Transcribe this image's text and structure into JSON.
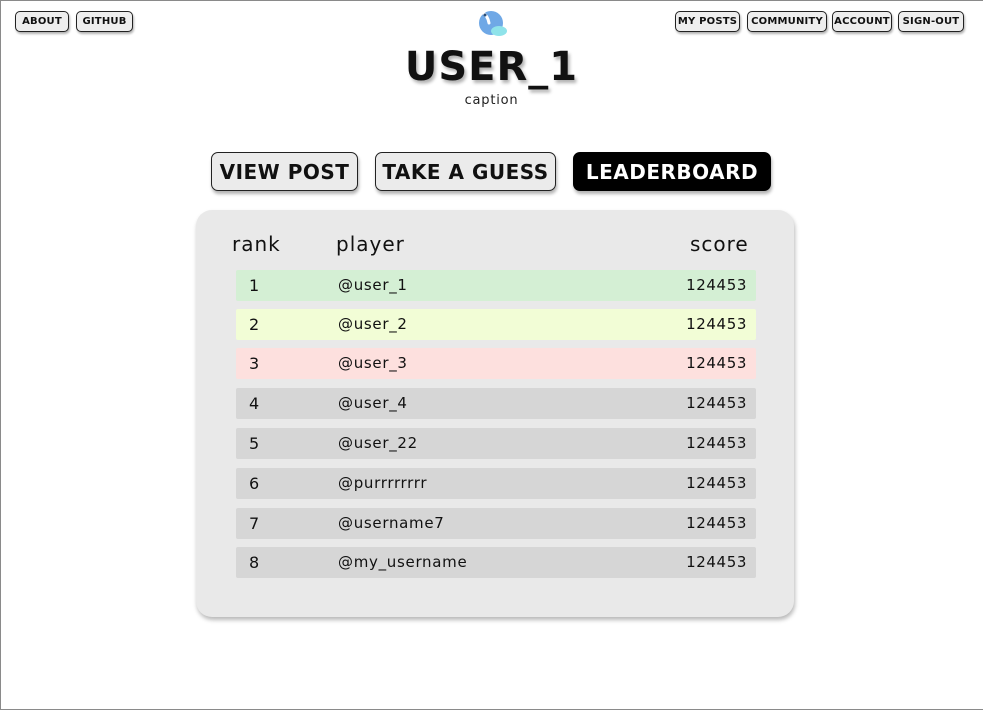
{
  "nav": {
    "left": [
      "about",
      "github"
    ],
    "right": [
      "my posts",
      "community",
      "account",
      "sign-out"
    ]
  },
  "header": {
    "title": "USER_1",
    "caption": "caption"
  },
  "tabs": [
    {
      "label": "view post",
      "active": false
    },
    {
      "label": "take a guess",
      "active": false
    },
    {
      "label": "leaderboard",
      "active": true
    }
  ],
  "leaderboard": {
    "columns": {
      "rank": "rank",
      "player": "player",
      "score": "score"
    },
    "rows": [
      {
        "rank": "1",
        "player": "@user_1",
        "score": "124453",
        "color": "#d4efd4"
      },
      {
        "rank": "2",
        "player": "@user_2",
        "score": "124453",
        "color": "#f2fdd6"
      },
      {
        "rank": "3",
        "player": "@user_3",
        "score": "124453",
        "color": "#fde0de"
      },
      {
        "rank": "4",
        "player": "@user_4",
        "score": "124453",
        "color": "#d6d6d6"
      },
      {
        "rank": "5",
        "player": "@user_22",
        "score": "124453",
        "color": "#d6d6d6"
      },
      {
        "rank": "6",
        "player": "@purrrrrrrr",
        "score": "124453",
        "color": "#d6d6d6"
      },
      {
        "rank": "7",
        "player": "@username7",
        "score": "124453",
        "color": "#d6d6d6"
      },
      {
        "rank": "8",
        "player": "@my_username",
        "score": "124453",
        "color": "#d6d6d6"
      }
    ]
  },
  "icons": {
    "logo": "blue-blob-logo-icon"
  },
  "colors": {
    "active_tab": "#000000",
    "tab_bg": "#ebebeb",
    "board_bg": "#e9e9e9",
    "logo_blue": "#6fa8e6",
    "logo_teal": "#8fe3ea"
  }
}
